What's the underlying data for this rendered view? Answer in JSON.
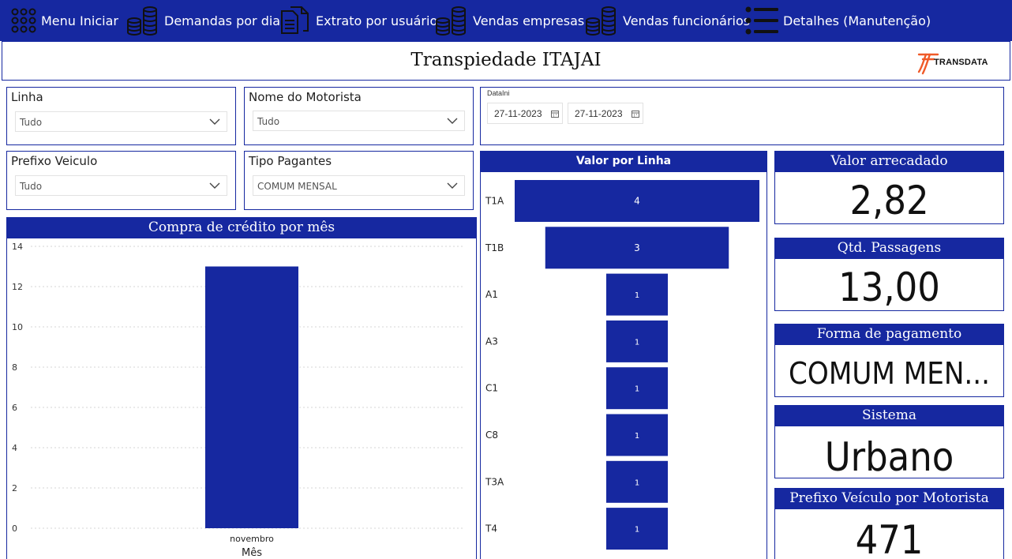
{
  "nav": {
    "items": [
      {
        "label": "Menu Iniciar",
        "icon": "grid-dots-icon"
      },
      {
        "label": "Demandas por dia",
        "icon": "coin-stacks-icon"
      },
      {
        "label": "Extrato por usuário",
        "icon": "documents-icon"
      },
      {
        "label": "Vendas empresas",
        "icon": "coin-stacks-icon"
      },
      {
        "label": "Vendas funcionários",
        "icon": "coin-stacks-icon"
      },
      {
        "label": "Detalhes (Manutenção)",
        "icon": "list-icon"
      }
    ]
  },
  "header": {
    "title": "Transpiedade ITAJAI",
    "logo_text": "TRANSDATA"
  },
  "filters": {
    "linha": {
      "title": "Linha",
      "value": "Tudo"
    },
    "motorista": {
      "title": "Nome do Motorista",
      "value": "Tudo"
    },
    "prefixo": {
      "title": "Prefixo Veiculo",
      "value": "Tudo"
    },
    "tipo_pagantes": {
      "title": "Tipo Pagantes",
      "value": "COMUM MENSAL"
    },
    "data": {
      "title": "DataIni",
      "start": "27-11-2023",
      "end": "27-11-2023"
    }
  },
  "colors": {
    "brand_blue": "#1628a0",
    "logo_orange": "#f05a28"
  },
  "cards": {
    "valor_arrecadado": {
      "title": "Valor arrecadado",
      "value": "2,82"
    },
    "qtd_passagens": {
      "title": "Qtd. Passagens",
      "value": "13,00"
    },
    "forma_pagamento": {
      "title": "Forma de pagamento",
      "value": "COMUM MEN..."
    },
    "sistema": {
      "title": "Sistema",
      "value": "Urbano"
    },
    "prefixo_motorista": {
      "title": "Prefixo Veículo por Motorista",
      "value": "471"
    }
  },
  "chart_data": [
    {
      "type": "bar",
      "title": "Compra de crédito por mês",
      "categories": [
        "novembro"
      ],
      "values": [
        13
      ],
      "xlabel": "Mês",
      "ylabel": "",
      "ylim": [
        0,
        14
      ],
      "yticks": [
        0,
        2,
        4,
        6,
        8,
        10,
        12,
        14
      ],
      "grid": true
    },
    {
      "type": "bar",
      "orientation": "horizontal-funnel",
      "title": "Valor por Linha",
      "categories": [
        "T1A",
        "T1B",
        "A1",
        "A3",
        "C1",
        "C8",
        "T3A",
        "T4"
      ],
      "values": [
        4,
        3,
        1,
        1,
        1,
        1,
        1,
        1
      ]
    }
  ]
}
